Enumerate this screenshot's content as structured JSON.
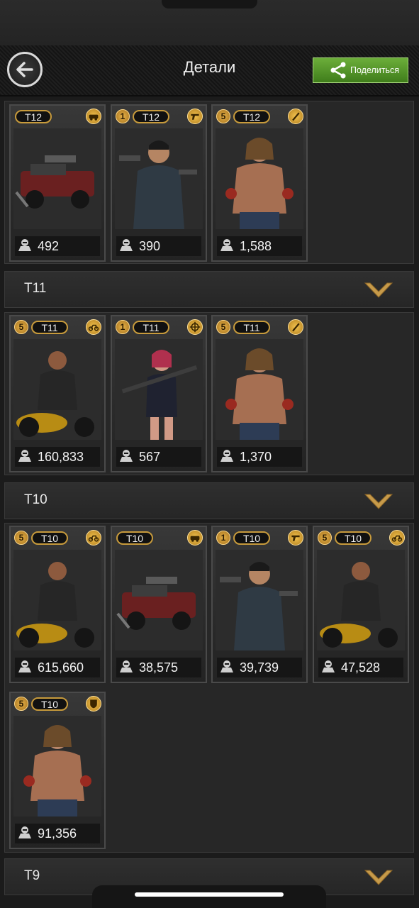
{
  "header": {
    "title": "Детали",
    "share_label": "Поделиться"
  },
  "groups": [
    {
      "tier": "",
      "cards": [
        {
          "tier": "T12",
          "level": "",
          "icon": "vehicle-icon",
          "power": "492",
          "figure": "truck"
        },
        {
          "tier": "T12",
          "level": "1",
          "icon": "pistol-icon",
          "power": "390",
          "figure": "gunman"
        },
        {
          "tier": "T12",
          "level": "5",
          "icon": "blade-icon",
          "power": "1,588",
          "figure": "brawler"
        }
      ]
    },
    {
      "tier": "T11",
      "cards": [
        {
          "tier": "T11",
          "level": "5",
          "icon": "motorcycle-icon",
          "power": "160,833",
          "figure": "biker"
        },
        {
          "tier": "T11",
          "level": "1",
          "icon": "crosshair-icon",
          "power": "567",
          "figure": "sniper"
        },
        {
          "tier": "T11",
          "level": "5",
          "icon": "blade-icon",
          "power": "1,370",
          "figure": "brawler"
        }
      ]
    },
    {
      "tier": "T10",
      "cards": [
        {
          "tier": "T10",
          "level": "5",
          "icon": "motorcycle-icon",
          "power": "615,660",
          "figure": "biker"
        },
        {
          "tier": "T10",
          "level": "",
          "icon": "vehicle-icon",
          "power": "38,575",
          "figure": "truck"
        },
        {
          "tier": "T10",
          "level": "1",
          "icon": "pistol-icon",
          "power": "39,739",
          "figure": "gunman"
        },
        {
          "tier": "T10",
          "level": "5",
          "icon": "motorcycle-icon",
          "power": "47,528",
          "figure": "biker"
        },
        {
          "tier": "T10",
          "level": "5",
          "icon": "shield-icon",
          "power": "91,356",
          "figure": "brawler"
        }
      ]
    },
    {
      "tier": "T9",
      "cards": []
    }
  ],
  "colors": {
    "accent_gold": "#c89b3c",
    "share_green": "#4f8f26",
    "panel": "#272727"
  }
}
